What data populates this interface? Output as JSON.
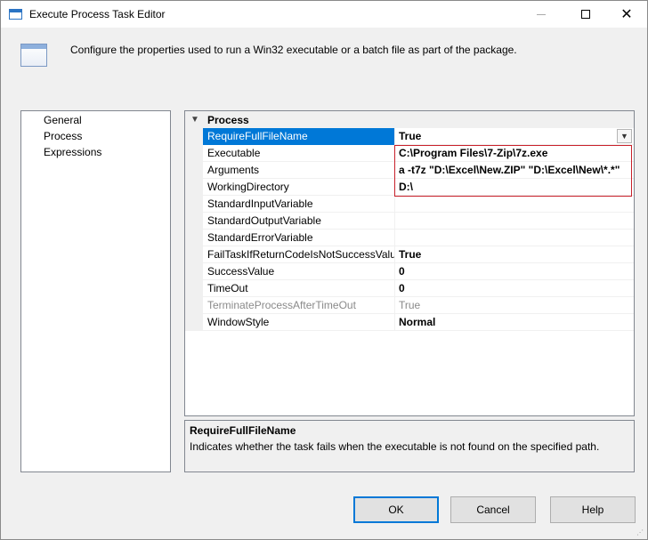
{
  "window": {
    "title": "Execute Process Task Editor"
  },
  "header": {
    "description": "Configure the properties used to run a Win32 executable or a batch file as part of the package."
  },
  "nav": {
    "items": [
      "General",
      "Process",
      "Expressions"
    ]
  },
  "grid": {
    "category": "Process",
    "rows": [
      {
        "name": "RequireFullFileName",
        "value": "True"
      },
      {
        "name": "Executable",
        "value": "C:\\Program Files\\7-Zip\\7z.exe"
      },
      {
        "name": "Arguments",
        "value": "a -t7z \"D:\\Excel\\New.ZIP\" \"D:\\Excel\\New\\*.*\""
      },
      {
        "name": "WorkingDirectory",
        "value": "D:\\"
      },
      {
        "name": "StandardInputVariable",
        "value": ""
      },
      {
        "name": "StandardOutputVariable",
        "value": ""
      },
      {
        "name": "StandardErrorVariable",
        "value": ""
      },
      {
        "name": "FailTaskIfReturnCodeIsNotSuccessValue",
        "value": "True"
      },
      {
        "name": "SuccessValue",
        "value": "0"
      },
      {
        "name": "TimeOut",
        "value": "0"
      },
      {
        "name": "TerminateProcessAfterTimeOut",
        "value": "True"
      },
      {
        "name": "WindowStyle",
        "value": "Normal"
      }
    ]
  },
  "description_pane": {
    "title": "RequireFullFileName",
    "text": "Indicates whether the task fails when the executable is not found on the specified path."
  },
  "buttons": {
    "ok": "OK",
    "cancel": "Cancel",
    "help": "Help"
  },
  "icons": {
    "title": "window-icon",
    "header": "task-icon",
    "category": "chevron-down-icon",
    "dropdown": "chevron-down-icon"
  }
}
